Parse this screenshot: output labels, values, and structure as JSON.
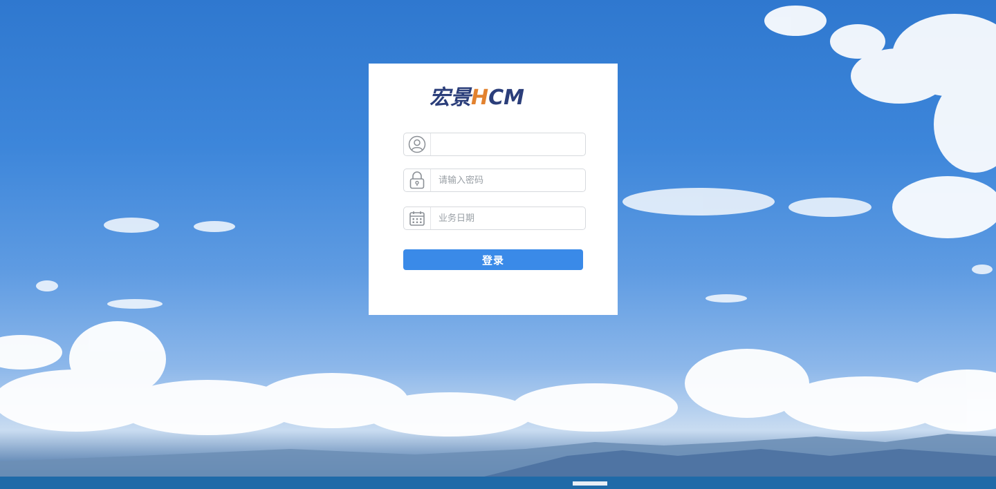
{
  "brand": {
    "logo_cn": "宏景",
    "logo_h": "H",
    "logo_cm": "CM",
    "logo_color": "#2b3e7a",
    "logo_accent": "#e2822f"
  },
  "form": {
    "username": {
      "value": "",
      "placeholder": "",
      "icon": "user-circle-icon"
    },
    "password": {
      "value": "",
      "placeholder": "请输入密码",
      "icon": "lock-icon"
    },
    "business_date": {
      "value": "",
      "placeholder": "业务日期",
      "icon": "calendar-icon"
    },
    "login_label": "登录"
  },
  "colors": {
    "primary_button": "#3a8ae8",
    "field_border": "#d6d9dd",
    "icon_gray": "#8a8f95"
  }
}
